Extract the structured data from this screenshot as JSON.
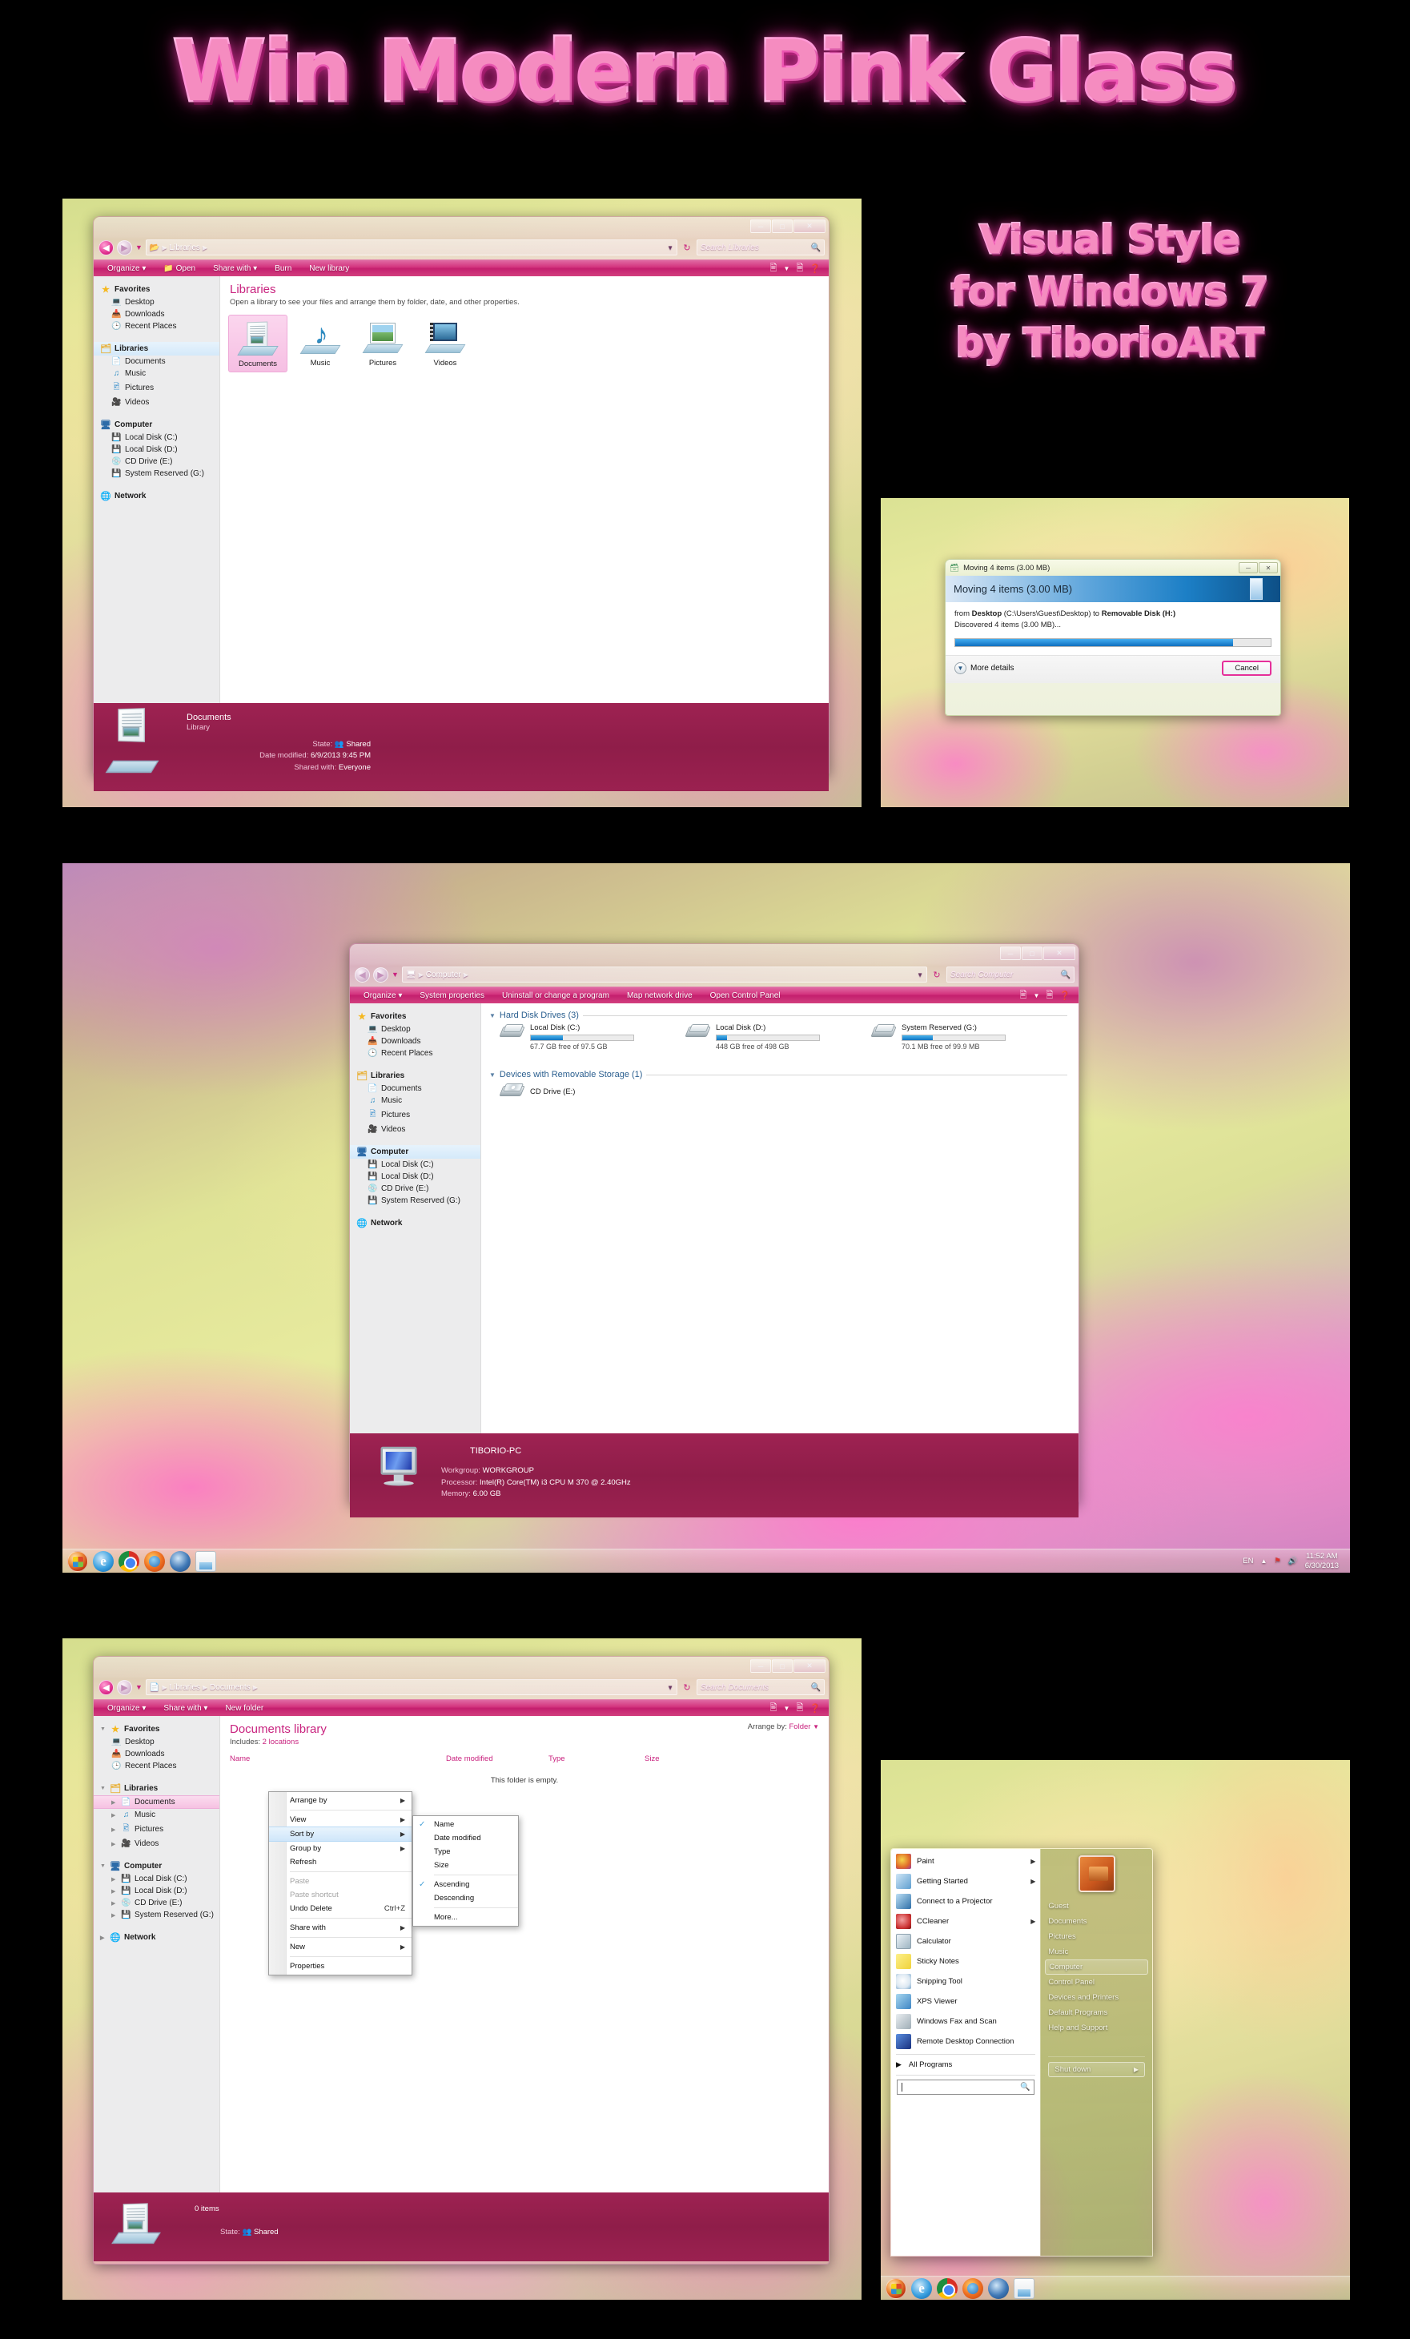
{
  "banner": {
    "title": "Win Modern Pink Glass",
    "subtitle_lines": [
      "Visual Style",
      "for Windows 7",
      "by TiborioART"
    ]
  },
  "window_libraries": {
    "breadcrumb": [
      "Libraries",
      ""
    ],
    "search_placeholder": "Search Libraries",
    "toolbar": [
      "Organize",
      "Open",
      "Share with",
      "Burn",
      "New library"
    ],
    "heading": "Libraries",
    "subheading": "Open a library to see your files and arrange them by folder, date, and other properties.",
    "tiles": [
      {
        "label": "Documents",
        "icon": "documents-library-icon",
        "selected": true
      },
      {
        "label": "Music",
        "icon": "music-library-icon",
        "selected": false
      },
      {
        "label": "Pictures",
        "icon": "pictures-library-icon",
        "selected": false
      },
      {
        "label": "Videos",
        "icon": "videos-library-icon",
        "selected": false
      }
    ],
    "nav": {
      "favorites": {
        "label": "Favorites",
        "items": [
          "Desktop",
          "Downloads",
          "Recent Places"
        ]
      },
      "libraries": {
        "label": "Libraries",
        "items": [
          "Documents",
          "Music",
          "Pictures",
          "Videos"
        ],
        "selected": true
      },
      "computer": {
        "label": "Computer",
        "items": [
          "Local Disk (C:)",
          "Local Disk (D:)",
          "CD Drive (E:)",
          "System Reserved (G:)"
        ]
      },
      "network": {
        "label": "Network"
      }
    },
    "status": {
      "name": "Documents",
      "type": "Library",
      "state_label": "State:",
      "state_value": "Shared",
      "date_label": "Date modified:",
      "date_value": "6/9/2013 9:45 PM",
      "shared_label": "Shared with:",
      "shared_value": "Everyone"
    }
  },
  "dialog_moving": {
    "caption": "Moving 4 items (3.00 MB)",
    "hero": "Moving 4 items (3.00 MB)",
    "line1_pre": "from ",
    "line1_from": "Desktop",
    "line1_path": " (C:\\Users\\Guest\\Desktop) to ",
    "line1_to": "Removable Disk (H:)",
    "line2": "Discovered 4 items (3.00 MB)...",
    "progress_percent": 88,
    "more_details": "More details",
    "cancel": "Cancel"
  },
  "window_computer": {
    "breadcrumb": [
      "Computer",
      ""
    ],
    "search_placeholder": "Search Computer",
    "toolbar": [
      "Organize",
      "System properties",
      "Uninstall or change a program",
      "Map network drive",
      "Open Control Panel"
    ],
    "groups": [
      {
        "title": "Hard Disk Drives (3)",
        "drives": [
          {
            "name": "Local Disk (C:)",
            "free": "67.7 GB free of 97.5 GB",
            "used_percent": 31
          },
          {
            "name": "Local Disk (D:)",
            "free": "448 GB free of 498 GB",
            "used_percent": 10
          },
          {
            "name": "System Reserved (G:)",
            "free": "70.1 MB free of 99.9 MB",
            "used_percent": 30
          }
        ]
      },
      {
        "title": "Devices with Removable Storage (1)",
        "drives": [
          {
            "name": "CD Drive (E:)",
            "free": "",
            "used_percent": 0
          }
        ]
      }
    ],
    "nav": {
      "favorites": {
        "label": "Favorites",
        "items": [
          "Desktop",
          "Downloads",
          "Recent Places"
        ]
      },
      "libraries": {
        "label": "Libraries",
        "items": [
          "Documents",
          "Music",
          "Pictures",
          "Videos"
        ]
      },
      "computer": {
        "label": "Computer",
        "items": [
          "Local Disk (C:)",
          "Local Disk (D:)",
          "CD Drive (E:)",
          "System Reserved (G:)"
        ],
        "selected": true
      },
      "network": {
        "label": "Network"
      }
    },
    "status": {
      "name": "TIBORIO-PC",
      "workgroup_label": "Workgroup:",
      "workgroup_value": "WORKGROUP",
      "processor_label": "Processor:",
      "processor_value": "Intel(R) Core(TM) i3 CPU     M 370  @ 2.40GHz",
      "memory_label": "Memory:",
      "memory_value": "6.00 GB"
    }
  },
  "taskbar": {
    "start_label": "start-orb",
    "pinned": [
      "internet-explorer-icon",
      "chrome-icon",
      "firefox-icon",
      "thunderbird-icon",
      "explorer-icon"
    ],
    "language": "EN",
    "time": "11:52 AM",
    "date": "6/30/2013"
  },
  "window_documents": {
    "breadcrumb": [
      "Libraries",
      "Documents",
      ""
    ],
    "search_placeholder": "Search Documents",
    "toolbar": [
      "Organize",
      "Share with",
      "New folder"
    ],
    "heading": "Documents library",
    "includes_label": "Includes:",
    "includes_value": "2 locations",
    "arrange_label": "Arrange by:",
    "arrange_value": "Folder",
    "columns": [
      "Name",
      "Date modified",
      "Type",
      "Size"
    ],
    "empty_text": "This folder is empty.",
    "nav": {
      "favorites": {
        "label": "Favorites",
        "items": [
          "Desktop",
          "Downloads",
          "Recent Places"
        ]
      },
      "libraries": {
        "label": "Libraries",
        "items": [
          "Documents",
          "Music",
          "Pictures",
          "Videos"
        ],
        "selected_item": "Documents"
      },
      "computer": {
        "label": "Computer",
        "items": [
          "Local Disk (C:)",
          "Local Disk (D:)",
          "CD Drive (E:)",
          "System Reserved (G:)"
        ]
      },
      "network": {
        "label": "Network"
      }
    },
    "status": {
      "items": "0 items",
      "state_label": "State:",
      "state_value": "Shared"
    }
  },
  "context_menu": {
    "items": [
      {
        "label": "Arrange by",
        "submenu": true,
        "disabled": false,
        "selected": false,
        "sep_after": true
      },
      {
        "label": "View",
        "submenu": true,
        "disabled": false,
        "selected": false
      },
      {
        "label": "Sort by",
        "submenu": true,
        "disabled": false,
        "selected": true
      },
      {
        "label": "Group by",
        "submenu": true,
        "disabled": false,
        "selected": false
      },
      {
        "label": "Refresh",
        "submenu": false,
        "disabled": false,
        "selected": false,
        "sep_after": true
      },
      {
        "label": "Paste",
        "submenu": false,
        "disabled": true,
        "selected": false
      },
      {
        "label": "Paste shortcut",
        "submenu": false,
        "disabled": true,
        "selected": false
      },
      {
        "label": "Undo Delete",
        "accel": "Ctrl+Z",
        "submenu": false,
        "disabled": false,
        "selected": false,
        "sep_after": true
      },
      {
        "label": "Share with",
        "submenu": true,
        "disabled": false,
        "selected": false,
        "sep_after": true
      },
      {
        "label": "New",
        "submenu": true,
        "disabled": false,
        "selected": false,
        "sep_after": true
      },
      {
        "label": "Properties",
        "submenu": false,
        "disabled": false,
        "selected": false
      }
    ]
  },
  "sort_submenu": {
    "items": [
      {
        "label": "Name",
        "checked": true
      },
      {
        "label": "Date modified",
        "checked": false
      },
      {
        "label": "Type",
        "checked": false
      },
      {
        "label": "Size",
        "checked": false,
        "sep_after": true
      },
      {
        "label": "Ascending",
        "checked": true
      },
      {
        "label": "Descending",
        "checked": false,
        "sep_after": true
      },
      {
        "label": "More...",
        "checked": false
      }
    ]
  },
  "start_menu": {
    "programs": [
      {
        "label": "Paint",
        "icon": "paint-icon",
        "submenu": true
      },
      {
        "label": "Getting Started",
        "icon": "getting-started-icon",
        "submenu": true
      },
      {
        "label": "Connect to a Projector",
        "icon": "projector-icon",
        "submenu": false
      },
      {
        "label": "CCleaner",
        "icon": "ccleaner-icon",
        "submenu": true
      },
      {
        "label": "Calculator",
        "icon": "calculator-icon",
        "submenu": false
      },
      {
        "label": "Sticky Notes",
        "icon": "sticky-notes-icon",
        "submenu": false
      },
      {
        "label": "Snipping Tool",
        "icon": "snipping-tool-icon",
        "submenu": false
      },
      {
        "label": "XPS Viewer",
        "icon": "xps-viewer-icon",
        "submenu": false
      },
      {
        "label": "Windows Fax and Scan",
        "icon": "fax-scan-icon",
        "submenu": false
      },
      {
        "label": "Remote Desktop Connection",
        "icon": "remote-desktop-icon",
        "submenu": false
      }
    ],
    "all_programs": "All Programs",
    "search_placeholder": "",
    "user": "Guest",
    "places": [
      {
        "label": "Documents",
        "selected": false
      },
      {
        "label": "Pictures",
        "selected": false
      },
      {
        "label": "Music",
        "selected": false
      },
      {
        "label": "Computer",
        "selected": true
      },
      {
        "label": "Control Panel",
        "selected": false
      },
      {
        "label": "Devices and Printers",
        "selected": false
      },
      {
        "label": "Default Programs",
        "selected": false
      },
      {
        "label": "Help and Support",
        "selected": false
      }
    ],
    "shutdown": "Shut down"
  },
  "colors": {
    "pink_accent": "#c9237f",
    "toolbar_pink": "#d4357f",
    "status_maroon": "#9b2150",
    "title_pink": "#f58cc0"
  }
}
